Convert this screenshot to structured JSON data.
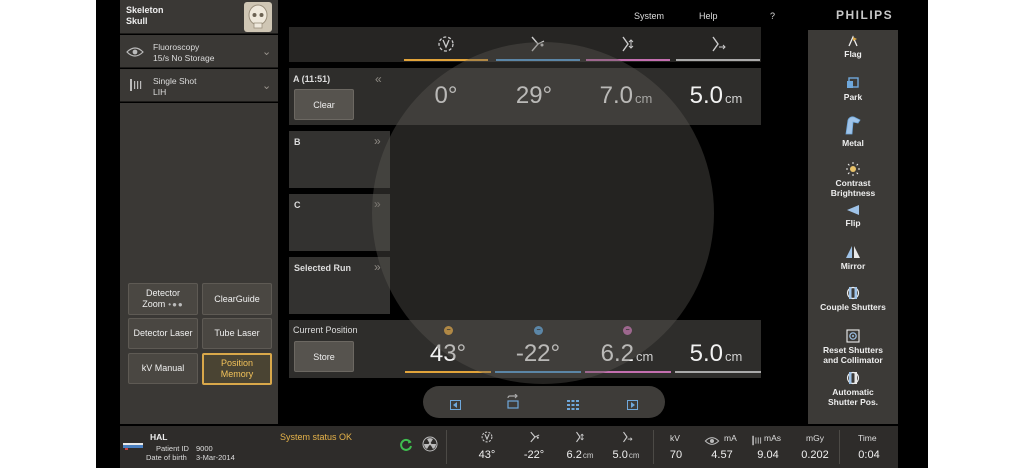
{
  "header": {
    "menu": [
      "System",
      "Help",
      "?"
    ],
    "brand": "PHILIPS"
  },
  "left_panel": {
    "protocol": {
      "title": "Skeleton",
      "subtitle": "Skull"
    },
    "fluoro": {
      "title": "Fluoroscopy",
      "subtitle": "15/s  No Storage"
    },
    "shot": {
      "title": "Single Shot",
      "subtitle": "LIH"
    },
    "buttons": {
      "detector_zoom": "Detector",
      "detector_zoom_2": "Zoom",
      "clearguide": "ClearGuide",
      "detector_laser": "Detector Laser",
      "tube_laser": "Tube Laser",
      "kv_manual": "kV Manual",
      "position_memory_1": "Position",
      "position_memory_2": "Memory"
    }
  },
  "positions": {
    "column_colors": [
      "#e2a43a",
      "#5aa0d8",
      "#c46fb0",
      "#aaaaaa"
    ],
    "a": {
      "label": "A (11:51)",
      "button": "Clear",
      "values": [
        "0°",
        "29°",
        "7.0",
        "5.0"
      ],
      "units": [
        "",
        "",
        "cm",
        "cm"
      ]
    },
    "b": {
      "label": "B"
    },
    "c": {
      "label": "C"
    },
    "selected": {
      "label": "Selected Run"
    },
    "current": {
      "label": "Current Position",
      "button": "Store",
      "values": [
        "43°",
        "-22°",
        "6.2",
        "5.0"
      ],
      "units": [
        "",
        "",
        "cm",
        "cm"
      ]
    }
  },
  "right_panel": {
    "tools": [
      "Flag",
      "Park",
      "Metal",
      "Contrast",
      "Brightness",
      "Flip",
      "Mirror",
      "Couple Shutters",
      "Reset Shutters",
      "and Collimator",
      "Automatic",
      "Shutter Pos."
    ]
  },
  "status_bar": {
    "patient_name": "HAL",
    "patient_id_label": "Patient ID",
    "patient_id": "9000",
    "dob_label": "Date of birth",
    "dob": "3-Mar-2014",
    "system_status": "System status OK",
    "geo_values": [
      "43°",
      "-22°",
      "6.2",
      "5.0"
    ],
    "geo_units": [
      "",
      "",
      "cm",
      "cm"
    ],
    "labels": {
      "kv": "kV",
      "ma": "mA",
      "mas": "mAs",
      "mgy": "mGy",
      "time": "Time"
    },
    "values": {
      "kv": "70",
      "ma": "4.57",
      "mas": "9.04",
      "mgy": "0.202",
      "time": "0:04"
    }
  }
}
